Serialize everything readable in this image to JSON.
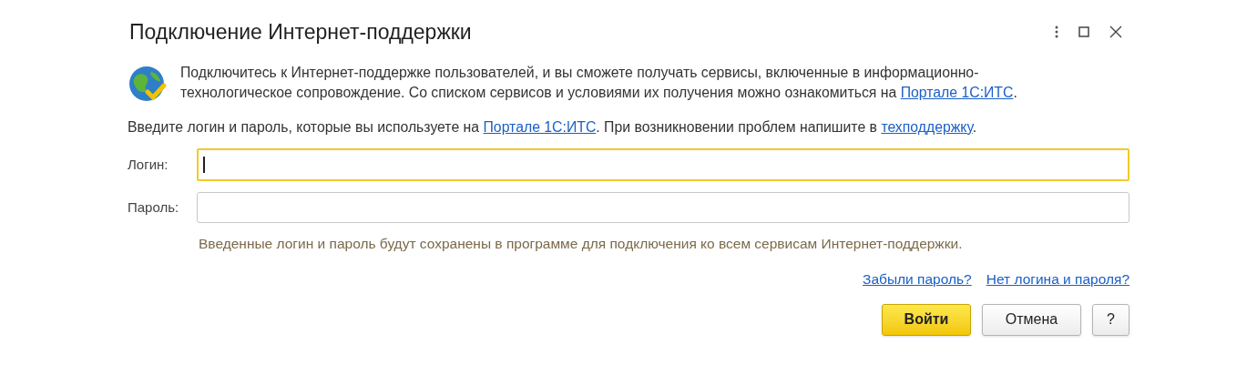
{
  "window": {
    "title": "Подключение Интернет-поддержки"
  },
  "intro": [
    {
      "text": "Подключитесь к Интернет-поддержке пользователей, и вы сможете получать сервисы, включенные в информационно-технологическое сопровождение. Со списком сервисов и условиями их получения можно ознакомиться на "
    },
    {
      "text": "Портале 1С:ИТС",
      "link": true
    },
    {
      "text": "."
    }
  ],
  "instructions": [
    {
      "text": "Введите логин и пароль, которые вы используете на "
    },
    {
      "text": "Портале 1С:ИТС",
      "link": true
    },
    {
      "text": ". При возникновении проблем напишите в "
    },
    {
      "text": "техподдержку",
      "link": true
    },
    {
      "text": "."
    }
  ],
  "fields": [
    {
      "label": "Логин:",
      "focused": true
    },
    {
      "label": "Пароль:",
      "focused": false
    }
  ],
  "hint": "Введенные логин и пароль будут сохранены в программе для подключения ко всем сервисам Интернет-поддержки.",
  "links": [
    "Забыли пароль?",
    "Нет логина и пароля?"
  ],
  "buttons": [
    {
      "label": "Войти",
      "kind": "primary"
    },
    {
      "label": "Отмена",
      "kind": "default"
    },
    {
      "label": "?",
      "kind": "help"
    }
  ]
}
